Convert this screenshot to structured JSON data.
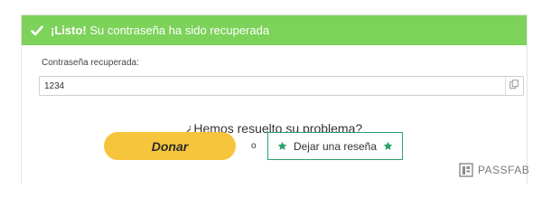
{
  "banner": {
    "strong": "¡Listo!",
    "text": " Su contraseña ha sido recuperada",
    "icon": "check-icon",
    "color": "#7dd25a"
  },
  "recovered": {
    "label": "Contraseña recuperada:",
    "value": "1234",
    "copy_icon": "copy-icon"
  },
  "feedback": {
    "question": "¿Hemos resuelto su problema?",
    "donate_label": "Donar",
    "donate_color": "#f7c53b",
    "or_label": "o",
    "review_label": "Dejar una reseña",
    "review_color": "#2aa26a",
    "star_icon": "star-icon"
  },
  "brand": {
    "name": "PASSFAB",
    "logo_icon": "passfab-logo-icon"
  }
}
